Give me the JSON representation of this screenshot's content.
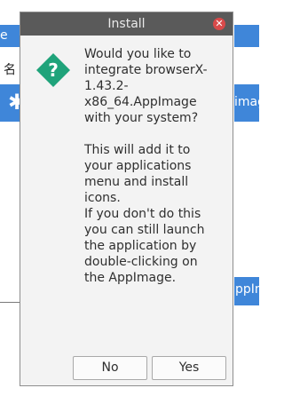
{
  "background": {
    "left_bar_text": "e",
    "left_column_text": "名",
    "left_row_icon": "gear-icon",
    "right_row_text": "imag",
    "right_row2_text": "ppIm"
  },
  "dialog": {
    "title": "Install",
    "icon": "question-icon",
    "question": "Would you like to integrate browserX-1.43.2-x86_64.AppImage with your system?",
    "details": "This will add it to your applications menu and install icons.\nIf you don't do this you can still launch the application by double-clicking on the AppImage.",
    "buttons": {
      "no": "No",
      "yes": "Yes"
    },
    "colors": {
      "titlebar": "#5a5a5a",
      "close": "#d94a4a",
      "icon": "#1fa37a"
    }
  }
}
